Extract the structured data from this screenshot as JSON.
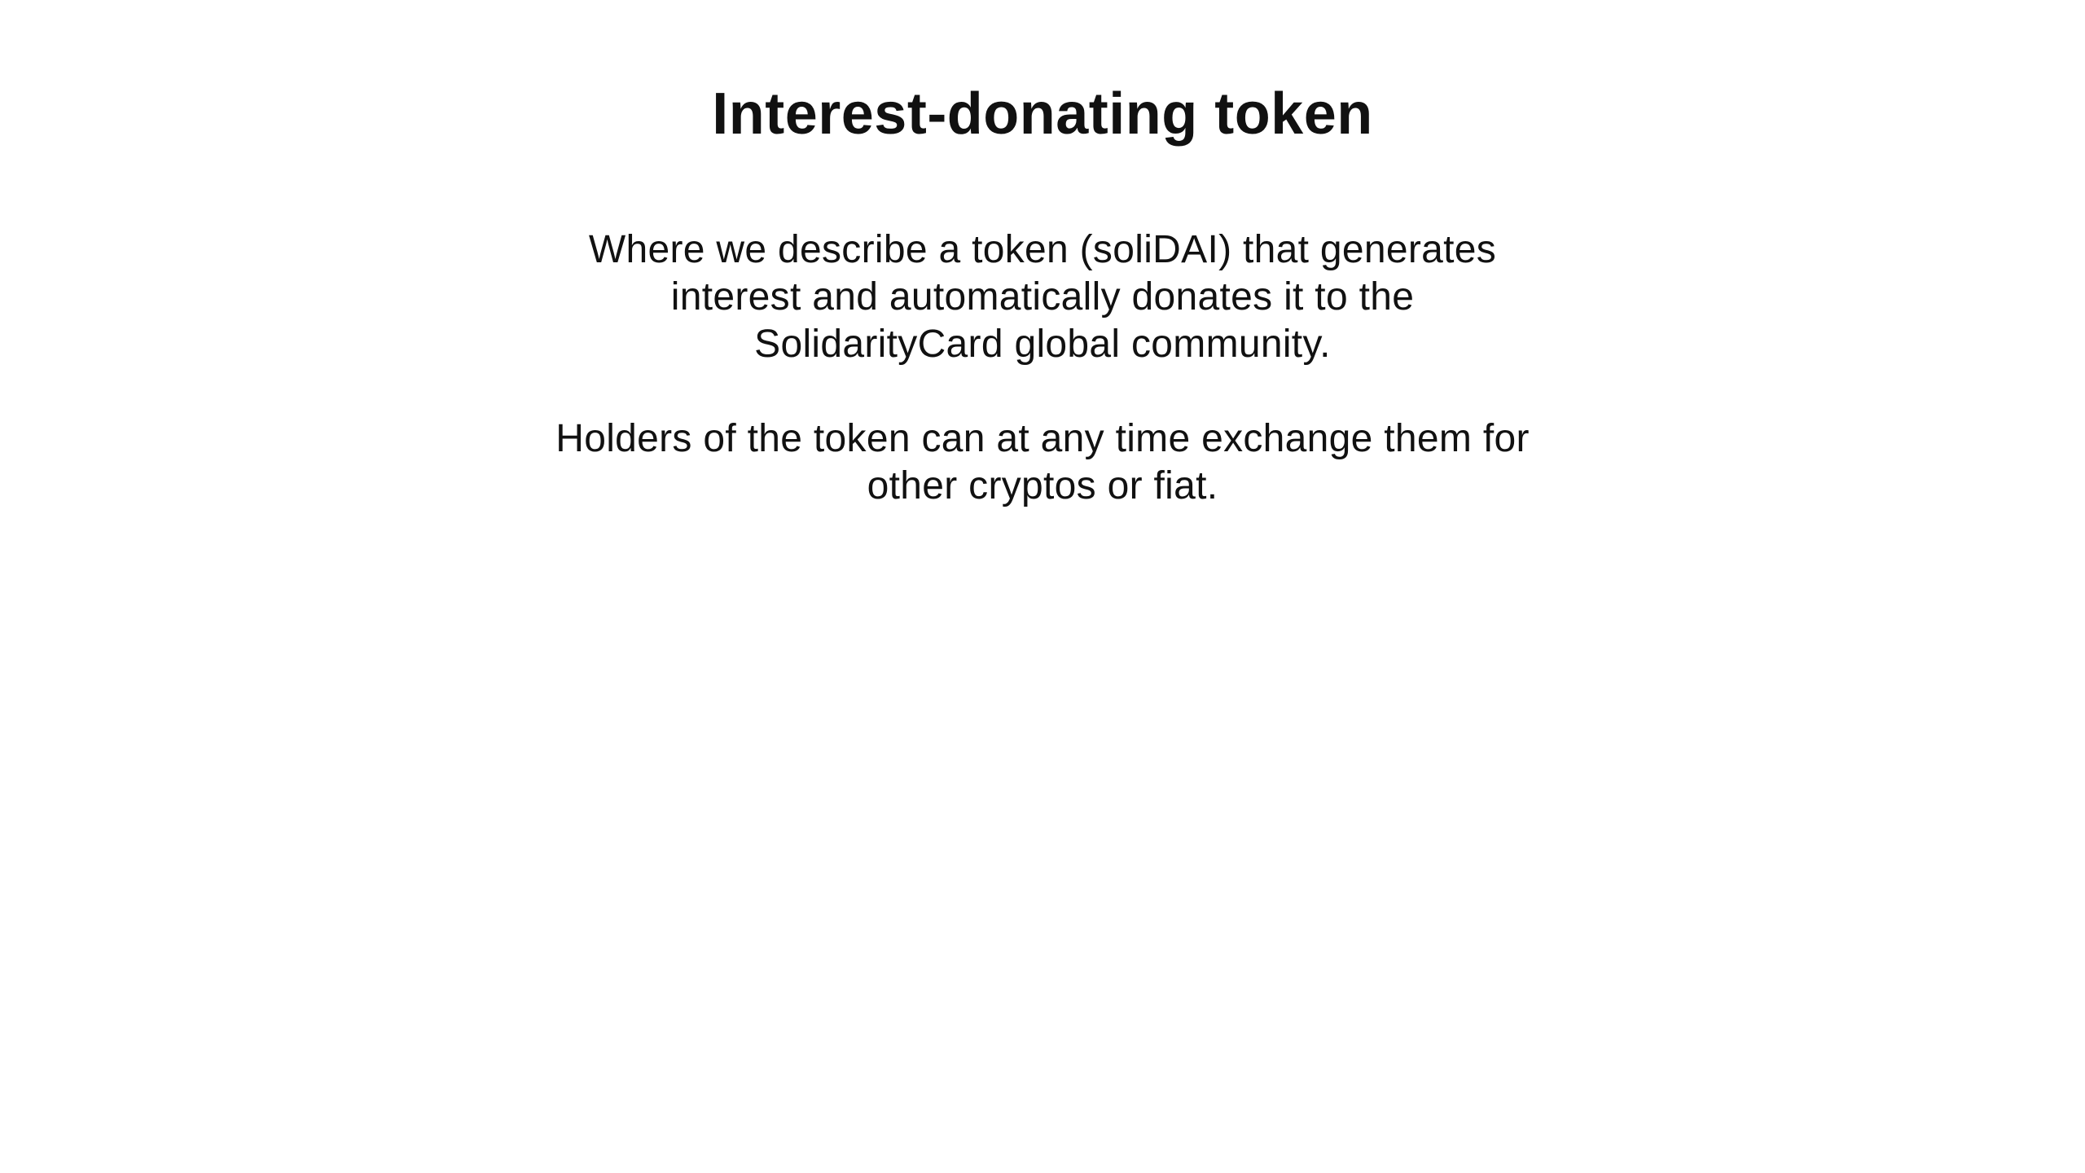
{
  "heading": "Interest-donating token",
  "paragraphs": [
    "Where we describe a token (soliDAI) that generates\ninterest and automatically donates it to the\nSolidarityCard global community.",
    "Holders of the token can at any time exchange them for\nother cryptos or fiat."
  ]
}
